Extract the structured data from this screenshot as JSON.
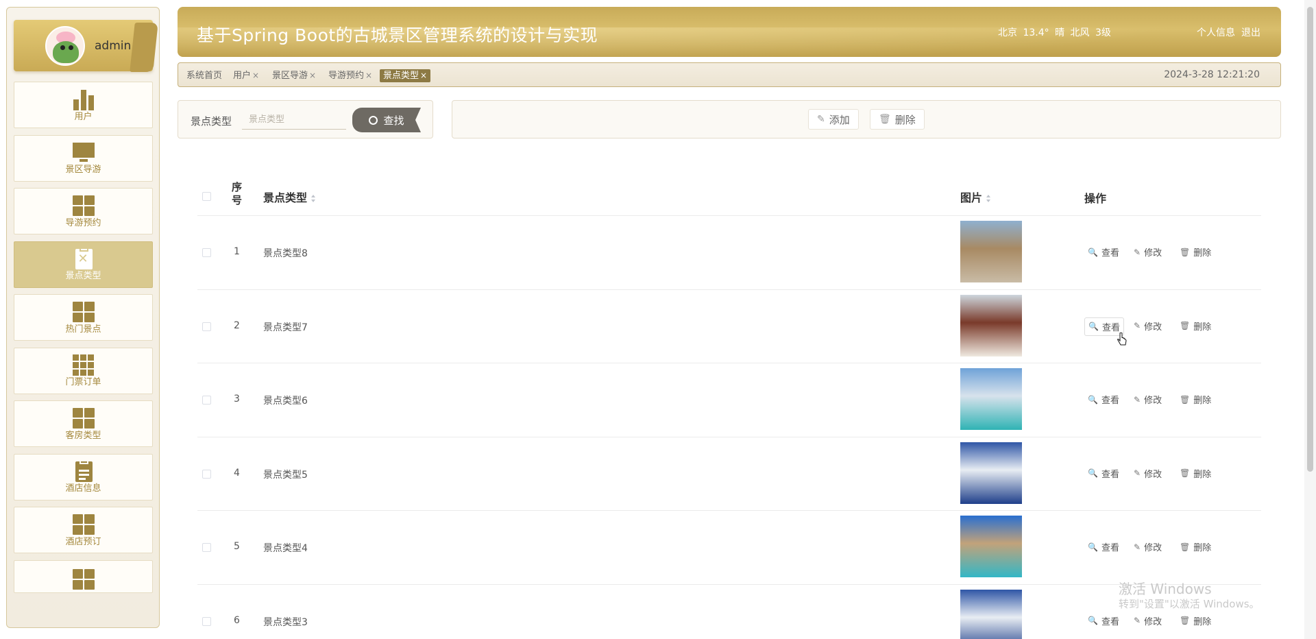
{
  "sidebar": {
    "user_name": "admin",
    "items": [
      {
        "label": "用户",
        "icon": "bar-chart-icon"
      },
      {
        "label": "景区导游",
        "icon": "monitor-icon"
      },
      {
        "label": "导游预约",
        "icon": "grid-icon"
      },
      {
        "label": "景点类型",
        "icon": "clipboard-x-icon",
        "active": true
      },
      {
        "label": "热门景点",
        "icon": "grid-icon"
      },
      {
        "label": "门票订单",
        "icon": "grid-9-icon"
      },
      {
        "label": "客房类型",
        "icon": "grid-icon"
      },
      {
        "label": "酒店信息",
        "icon": "clipboard-icon"
      },
      {
        "label": "酒店预订",
        "icon": "grid-icon"
      },
      {
        "label": "",
        "icon": "grid-icon"
      }
    ]
  },
  "header": {
    "title": "基于Spring Boot的古城景区管理系统的设计与实现",
    "weather": "北京 13.4° 晴 北风 3级",
    "profile_link": "个人信息",
    "logout_link": "退出"
  },
  "tabs": [
    {
      "label": "系统首页",
      "closable": false
    },
    {
      "label": "用户",
      "closable": true
    },
    {
      "label": "景区导游",
      "closable": true
    },
    {
      "label": "导游预约",
      "closable": true
    },
    {
      "label": "景点类型",
      "closable": true,
      "active": true
    }
  ],
  "tab_close_glyph": "×",
  "datetime": "2024-3-28 12:21:20",
  "search": {
    "label": "景点类型",
    "placeholder": "景点类型",
    "button": "查找"
  },
  "actions": {
    "add": "添加",
    "delete": "删除"
  },
  "table": {
    "columns": {
      "index": "序号",
      "type": "景点类型",
      "image": "图片",
      "ops": "操作"
    },
    "op_labels": {
      "view": "查看",
      "edit": "修改",
      "delete": "删除"
    },
    "rows": [
      {
        "index": "1",
        "type": "景点类型8",
        "thumb_colors": [
          "#8fb0cf",
          "#a88a63",
          "#c9bba6"
        ]
      },
      {
        "index": "2",
        "type": "景点类型7",
        "thumb_colors": [
          "#cdd6dd",
          "#7a3a2a",
          "#efe9e0"
        ]
      },
      {
        "index": "3",
        "type": "景点类型6",
        "thumb_colors": [
          "#6fa2d8",
          "#d7e2ec",
          "#2fb3b4"
        ]
      },
      {
        "index": "4",
        "type": "景点类型5",
        "thumb_colors": [
          "#2f56a6",
          "#e8edf3",
          "#1f3f8a"
        ]
      },
      {
        "index": "5",
        "type": "景点类型4",
        "thumb_colors": [
          "#2a6fcf",
          "#c2a27a",
          "#33b7c6"
        ]
      },
      {
        "index": "6",
        "type": "景点类型3",
        "thumb_colors": [
          "#2f56a6",
          "#e8edf3",
          "#1f3f8a"
        ]
      }
    ]
  },
  "watermark": {
    "line1": "激活 Windows",
    "line2": "转到\"设置\"以激活 Windows。"
  },
  "colors": {
    "accent": "#c8ab58",
    "active_menu": "#d9c98f",
    "icon": "#9e8540"
  }
}
